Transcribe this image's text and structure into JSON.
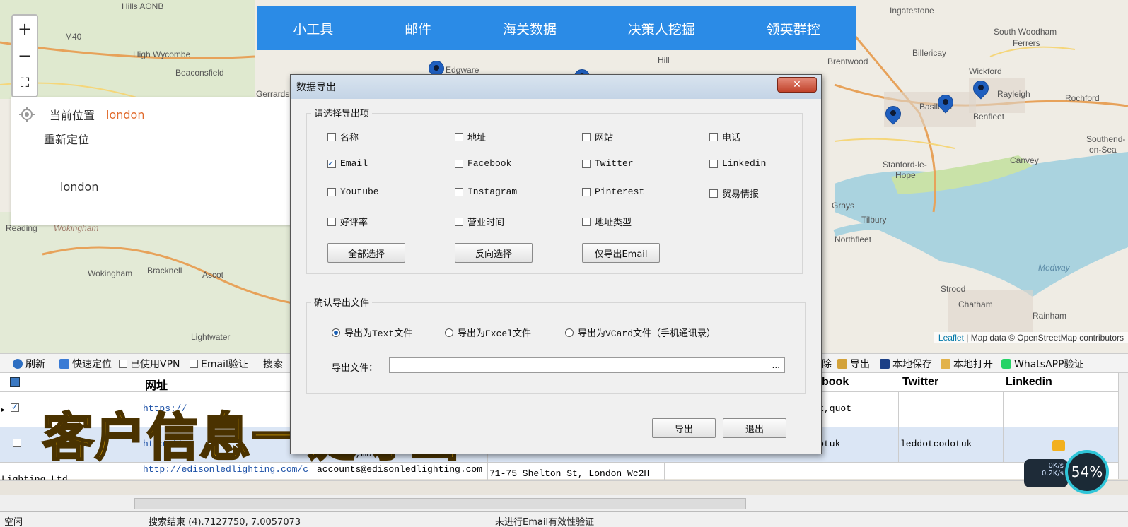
{
  "map": {
    "labels": {
      "chilterns": "Hills AONB",
      "m40": "M40",
      "high_wycombe": "High Wycombe",
      "beaconsfield": "Beaconsfield",
      "gerrards": "Gerrards",
      "reading": "Reading",
      "wokingham_it": "Wokingham",
      "wokingham": "Wokingham",
      "bracknell": "Bracknell",
      "ascot": "Ascot",
      "lightwater": "Lightwater",
      "edgware": "Edgware",
      "hill": "Hill",
      "ingatestone": "Ingatestone",
      "south_woodham": "South Woodham",
      "ferrers": "Ferrers",
      "billericay": "Billericay",
      "brentwood": "Brentwood",
      "wickford": "Wickford",
      "rayleigh": "Rayleigh",
      "rochford": "Rochford",
      "basildon": "Basildon",
      "benfleet": "Benfleet",
      "southend": "Southend-",
      "on_sea": "on-Sea",
      "stanford": "Stanford-le-",
      "hope": "Hope",
      "canvey": "Canvey",
      "grays": "Grays",
      "tilbury": "Tilbury",
      "northfleet": "Northfleet",
      "medway": "Medway",
      "strood": "Strood",
      "chatham": "Chatham",
      "rainham": "Rainham"
    },
    "attribution_leaflet": "Leaflet",
    "attribution_rest": " | Map data © OpenStreetMap contributors",
    "zoom_in": "+",
    "zoom_out": "−",
    "fullscreen_icon": "⛶"
  },
  "location_panel": {
    "current_label": "当前位置",
    "current_city": "london",
    "relocate_label": "重新定位",
    "input_value": "london"
  },
  "topnav": [
    "小工具",
    "邮件",
    "海关数据",
    "决策人挖掘",
    "领英群控"
  ],
  "toolbar": {
    "refresh": "刷新",
    "quick_locate": "快速定位",
    "vpn": "已使用VPN",
    "email_verify": "Email验证",
    "search": "搜索",
    "delete_tail": "除",
    "export": "导出",
    "local_save": "本地保存",
    "local_open": "本地打开",
    "whatsapp": "WhatsAPP验证"
  },
  "grid": {
    "headers": {
      "url": "网址",
      "facebook": "book",
      "twitter": "Twitter",
      "linkedin": "Linkedin"
    },
    "rows": [
      {
        "url": "https://",
        "facebook": "ghtuk,quot",
        "twitter": "",
        "checked": true
      },
      {
        "url": "http://",
        "email": "d.co.uk,ma",
        "facebook": "tcodotuk",
        "twitter": "leddotcodotuk",
        "checked": false
      },
      {
        "name": "Lighting Ltd",
        "url": "http://edisonledlighting.com/c",
        "email": "accounts@edisonledlighting.com",
        "address": "71-75 Shelton St, London Wc2H",
        "facebook": "",
        "twitter": "",
        "checked": false
      }
    ]
  },
  "status": {
    "left": "空闲",
    "mid": "搜索结束 (4).7127750, 7.0057073",
    "right": "未进行Email有效性验证"
  },
  "caption": "客户信息一键导出",
  "net": {
    "up": "0K/s",
    "down": "0.2K/s",
    "cpu": "54%"
  },
  "dialog": {
    "title": "数据导出",
    "close": "✕",
    "section1": "请选择导出项",
    "options": [
      {
        "label": "名称",
        "checked": false
      },
      {
        "label": "地址",
        "checked": false
      },
      {
        "label": "网站",
        "checked": false
      },
      {
        "label": "电话",
        "checked": false
      },
      {
        "label": "Email",
        "checked": true
      },
      {
        "label": "Facebook",
        "checked": false
      },
      {
        "label": "Twitter",
        "checked": false
      },
      {
        "label": "Linkedin",
        "checked": false
      },
      {
        "label": "Youtube",
        "checked": false
      },
      {
        "label": "Instagram",
        "checked": false
      },
      {
        "label": "Pinterest",
        "checked": false
      },
      {
        "label": "贸易情报",
        "checked": false
      },
      {
        "label": "好评率",
        "checked": false
      },
      {
        "label": "营业时间",
        "checked": false
      },
      {
        "label": "地址类型",
        "checked": false
      }
    ],
    "select_all": "全部选择",
    "invert": "反向选择",
    "email_only": "仅导出Email",
    "section2": "确认导出文件",
    "formats": [
      {
        "label": "导出为Text文件",
        "selected": true
      },
      {
        "label": "导出为Excel文件",
        "selected": false
      },
      {
        "label": "导出为VCard文件（手机通讯录）",
        "selected": false
      }
    ],
    "file_label": "导出文件：",
    "file_value": "",
    "browse": "...",
    "export_btn": "导出",
    "exit_btn": "退出"
  }
}
